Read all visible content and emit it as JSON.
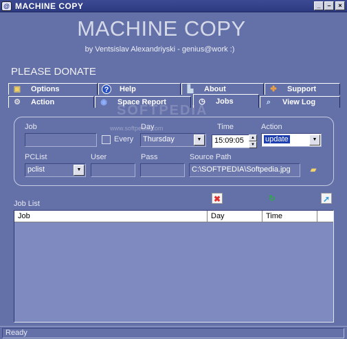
{
  "window": {
    "title": "MACHINE COPY",
    "app_icon": "@",
    "controls": [
      "_",
      "–",
      "×"
    ]
  },
  "header": {
    "heading": "MACHINE COPY",
    "byline": "by Ventsislav Alexandriyski - genius@work :)",
    "donate": "PLEASE DONATE"
  },
  "tabs_row1": [
    {
      "label": "Options",
      "icon": "folder-icon",
      "glyph": "▣"
    },
    {
      "label": "Help",
      "icon": "help-icon",
      "glyph": "?"
    },
    {
      "label": "About",
      "icon": "about-icon",
      "glyph": "▙"
    },
    {
      "label": "Support",
      "icon": "support-icon",
      "glyph": "✤"
    }
  ],
  "tabs_row2": [
    {
      "label": "Action",
      "icon": "action-icon",
      "glyph": "⚙"
    },
    {
      "label": "Space Report",
      "icon": "disk-icon",
      "glyph": "◉"
    },
    {
      "label": "Jobs",
      "icon": "clock-icon",
      "glyph": "◷"
    },
    {
      "label": "View Log",
      "icon": "magnifier-icon",
      "glyph": "⌕"
    }
  ],
  "form": {
    "job_label": "Job",
    "job_value": "",
    "every_label": "Every",
    "day_label": "Day",
    "day_value": "Thursday",
    "time_label": "Time",
    "time_value": "15:09:05",
    "action_label": "Action",
    "action_value": "update",
    "pclist_label": "PCList",
    "pclist_value": "pclist",
    "user_label": "User",
    "user_value": "",
    "pass_label": "Pass",
    "pass_value": "",
    "source_label": "Source Path",
    "source_value": "C:\\SOFTPEDIA\\Softpedia.jpg"
  },
  "job_list": {
    "label": "Job List",
    "columns": [
      "Job",
      "Day",
      "Time",
      ""
    ],
    "rows": []
  },
  "toolbar": {
    "delete_glyph": "✖",
    "refresh_glyph": "↻",
    "export_glyph": "➚"
  },
  "status": {
    "text": "Ready"
  },
  "watermark": {
    "text": "SOFTPEDIA",
    "url": "www.softpedia.com"
  },
  "colors": {
    "background": "#6470a8",
    "titlebar": "#2c3a82",
    "selection": "#1d3fb0",
    "delete_icon": "#e03030",
    "refresh_icon": "#2ea84a",
    "export_icon": "#39a0d8"
  }
}
